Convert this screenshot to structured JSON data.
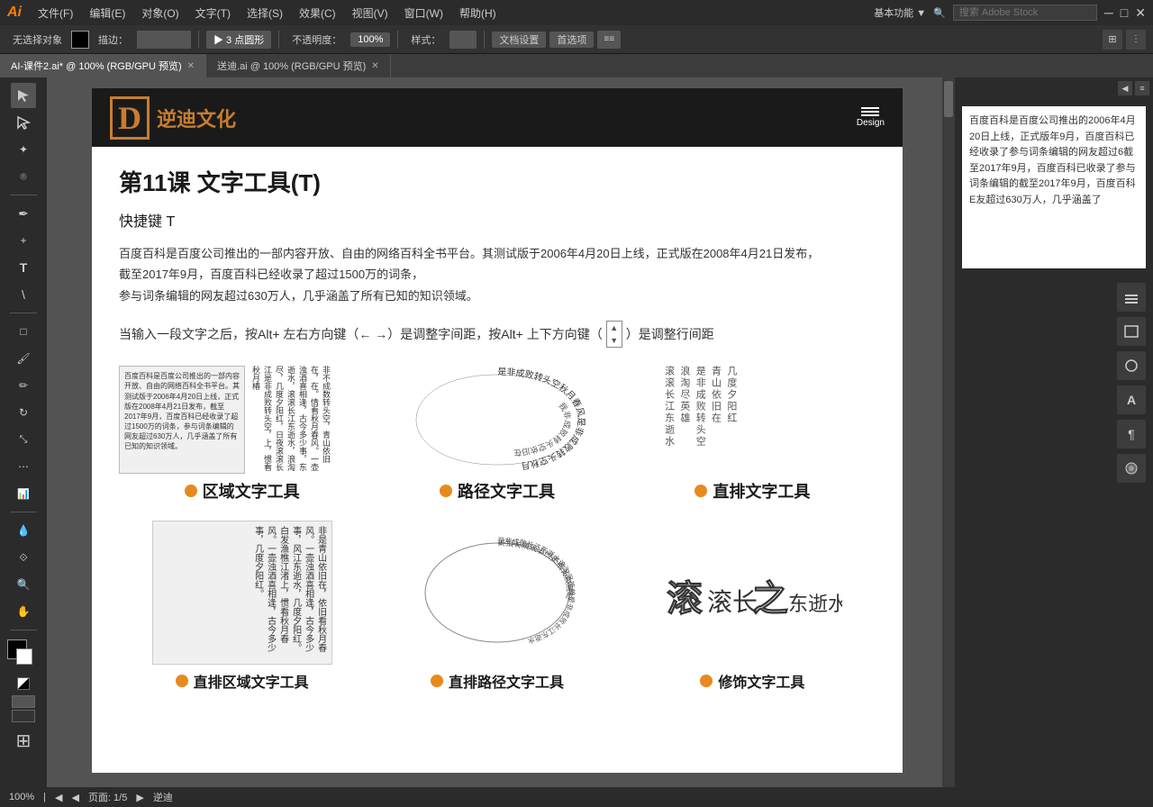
{
  "app": {
    "logo": "Ai",
    "menus": [
      "文件(F)",
      "编辑(E)",
      "对象(O)",
      "文字(T)",
      "选择(S)",
      "效果(C)",
      "视图(V)",
      "窗口(W)",
      "帮助(H)"
    ]
  },
  "toolbar": {
    "no_selection": "无选择对象",
    "blend_mode": "描边：",
    "point_label": "▶ 3 点圆形",
    "opacity_label": "不透明度：",
    "opacity_value": "100%",
    "style_label": "样式：",
    "doc_settings": "文档设置",
    "preferences": "首选项"
  },
  "tabs": [
    {
      "label": "AI-课件2.ai* @ 100% (RGB/GPU 预览)",
      "active": true
    },
    {
      "label": "送迪.ai @ 100% (RGB/GPU 预览)",
      "active": false
    }
  ],
  "document": {
    "logo_char": "D",
    "logo_text": "逆迪文化",
    "design_label": "Design",
    "lesson_title": "第11课   文字工具(T)",
    "shortcut": "快捷键 T",
    "description_lines": [
      "百度百科是百度公司推出的一部内容开放、自由的网络百科全书平台。其测试版于2006年4月20日上线，正式版在2008年4月21日发布，",
      "截至2017年9月，百度百科已经收录了超过1500万的词条，",
      "参与词条编辑的网友超过630万人，几乎涵盖了所有已知的知识领域。"
    ],
    "shortcut_desc": "当输入一段文字之后，按Alt+ 左右方向键（← →）是调整字间距，按Alt+ 上下方向键（",
    "shortcut_desc2": "）是调整行间距",
    "tools": [
      {
        "name": "区域文字工具",
        "demo_type": "area",
        "demo_text": "百度百科是百度公司推出的一部内容开放、自由的网络百科全书平台。其测试版于2006年4月20日上线，正式版在2008年4月21日发布，截至2017年9月，百度百科已经收录了超过1500万的词条，参与词条编辑的网友超过630万人，几乎涵盖了所有已知的知识领域。",
        "side_text": "非不成\n数转头空，青山依旧在，\n在。情看秋月春风。一壶浊\n酒喜相逢，古今多少事，\n东逝水，滚滚长江东逝水，浪淘尽\n，几度夕阳红，日夜滚滚长江\n是非成败转头空，\n上，惯看秋月椿"
      },
      {
        "name": "路径文字工具",
        "demo_type": "path",
        "demo_text": "是非成败转头空秋月春风"
      },
      {
        "name": "直排文字工具",
        "demo_type": "vertical",
        "demo_text": "滚滚长江东逝水"
      }
    ],
    "bottom_tools": [
      {
        "name": "直排区域文字工具"
      },
      {
        "name": "直排路径文字工具"
      },
      {
        "name": "修饰文字工具"
      }
    ]
  },
  "right_panel": {
    "text": "百度百科是百度公司推出的2006年4月20日上线，正式版年9月，百度百科已经收录了参与词条编辑的网友超过6截至2017年9月，百度百科已收录了参与词条编辑的截至2017年9月，百度百科E友超过630万人，几乎涵盖了"
  },
  "status_bar": {
    "zoom": "100%",
    "page_info": "页面: 1/5",
    "layout_label": "逆迪"
  },
  "icons": {
    "hamburger": "☰",
    "arrow_up": "↑",
    "arrow_down": "↓",
    "arrow_left": "←",
    "arrow_right": "→"
  }
}
